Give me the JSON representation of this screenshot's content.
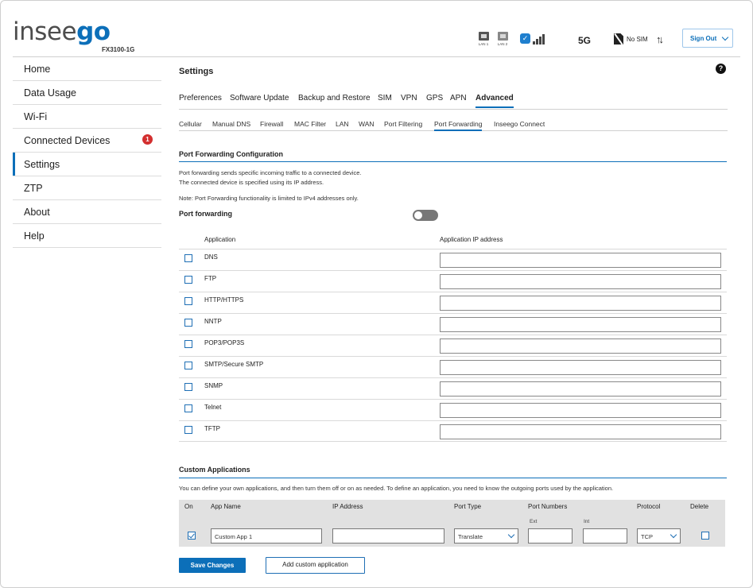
{
  "header": {
    "logo_main": "insee",
    "logo_accent": "go",
    "model": "FX3100-1G",
    "lan1": "LAN 1",
    "lan2": "LAN 2",
    "network": "5G",
    "sim_status": "No SIM",
    "data_arrows": "↑↓",
    "sign_out": "Sign Out",
    "signal_level": 4
  },
  "sidebar": {
    "items": [
      {
        "label": "Home"
      },
      {
        "label": "Data Usage"
      },
      {
        "label": "Wi-Fi"
      },
      {
        "label": "Connected Devices",
        "badge": "1"
      },
      {
        "label": "Settings",
        "active": true
      },
      {
        "label": "ZTP"
      },
      {
        "label": "About"
      },
      {
        "label": "Help"
      }
    ]
  },
  "main": {
    "title": "Settings",
    "help": "?",
    "tabs": [
      "Preferences",
      "Software Update",
      "Backup and Restore",
      "SIM",
      "VPN",
      "GPS",
      "APN",
      "Advanced"
    ],
    "active_tab": "Advanced",
    "subtabs": [
      "Cellular",
      "Manual DNS",
      "Firewall",
      "MAC Filter",
      "LAN",
      "WAN",
      "Port Filtering",
      "Port Forwarding",
      "Inseego Connect"
    ],
    "active_subtab": "Port Forwarding"
  },
  "port_forwarding": {
    "section_title": "Port Forwarding Configuration",
    "desc1": "Port forwarding sends specific incoming traffic to a connected device.",
    "desc2": "The connected device is specified using its IP address.",
    "note": "Note: Port Forwarding functionality is limited to IPv4 addresses only.",
    "toggle_label": "Port forwarding",
    "toggle_on": false,
    "col_application": "Application",
    "col_ip": "Application IP address",
    "apps": [
      "DNS",
      "FTP",
      "HTTP/HTTPS",
      "NNTP",
      "POP3/POP3S",
      "SMTP/Secure SMTP",
      "SNMP",
      "Telnet",
      "TFTP"
    ]
  },
  "custom": {
    "section_title": "Custom Applications",
    "desc": "You can define your own applications, and then turn them off or on as needed. To define an application, you need to know the outgoing ports used by the application.",
    "headers": {
      "on": "On",
      "app_name": "App Name",
      "ip": "IP Address",
      "port_type": "Port Type",
      "port_numbers": "Port Numbers",
      "protocol": "Protocol",
      "delete": "Delete"
    },
    "ext": "Ext",
    "int": "Int",
    "row": {
      "on": true,
      "app_name": "Custom App 1",
      "ip": "",
      "port_type": "Translate",
      "ext": "",
      "int": "",
      "protocol": "TCP",
      "delete": false
    }
  },
  "buttons": {
    "save": "Save Changes",
    "add": "Add custom application"
  }
}
